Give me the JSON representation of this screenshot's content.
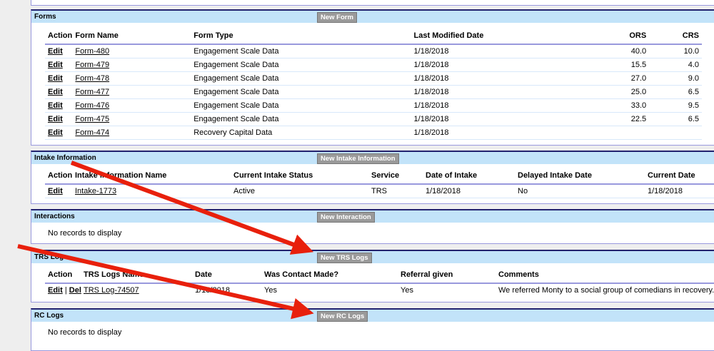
{
  "forms": {
    "title": "Forms",
    "new_button": "New Form",
    "headers": [
      "Action",
      "Form Name",
      "Form Type",
      "Last Modified Date",
      "ORS",
      "CRS"
    ],
    "rows": [
      {
        "action": "Edit",
        "name": "Form-480",
        "type": "Engagement Scale Data",
        "date": "1/18/2018",
        "ors": "40.0",
        "crs": "10.0"
      },
      {
        "action": "Edit",
        "name": "Form-479",
        "type": "Engagement Scale Data",
        "date": "1/18/2018",
        "ors": "15.5",
        "crs": "4.0"
      },
      {
        "action": "Edit",
        "name": "Form-478",
        "type": "Engagement Scale Data",
        "date": "1/18/2018",
        "ors": "27.0",
        "crs": "9.0"
      },
      {
        "action": "Edit",
        "name": "Form-477",
        "type": "Engagement Scale Data",
        "date": "1/18/2018",
        "ors": "25.0",
        "crs": "6.5"
      },
      {
        "action": "Edit",
        "name": "Form-476",
        "type": "Engagement Scale Data",
        "date": "1/18/2018",
        "ors": "33.0",
        "crs": "9.5"
      },
      {
        "action": "Edit",
        "name": "Form-475",
        "type": "Engagement Scale Data",
        "date": "1/18/2018",
        "ors": "22.5",
        "crs": "6.5"
      },
      {
        "action": "Edit",
        "name": "Form-474",
        "type": "Recovery Capital Data",
        "date": "1/18/2018",
        "ors": "",
        "crs": ""
      }
    ]
  },
  "intake": {
    "title": "Intake Information",
    "new_button": "New Intake Information",
    "headers": [
      "Action",
      "Intake Information Name",
      "Current Intake Status",
      "Service",
      "Date of Intake",
      "Delayed Intake Date",
      "Current Date"
    ],
    "rows": [
      {
        "action": "Edit",
        "name": "Intake-1773",
        "status": "Active",
        "service": "TRS",
        "date": "1/18/2018",
        "delayed": "No",
        "current": "1/18/2018"
      }
    ]
  },
  "interactions": {
    "title": "Interactions",
    "new_button": "New Interaction",
    "empty": "No records to display"
  },
  "trs": {
    "title": "TRS Logs",
    "new_button": "New TRS Logs",
    "headers": [
      "Action",
      "TRS Logs Name",
      "Date",
      "Was Contact Made?",
      "Referral given",
      "Comments"
    ],
    "rows": [
      {
        "edit": "Edit",
        "sep": "|",
        "del": "Del",
        "name": "TRS Log-74507",
        "date": "1/18/2018",
        "contact": "Yes",
        "referral": "Yes",
        "comments": "We referred Monty to a social group of comedians in recovery."
      }
    ]
  },
  "rc": {
    "title": "RC Logs",
    "new_button": "New RC Logs",
    "empty": "No records to display"
  },
  "colors": {
    "header_bg": "#c2e3f9",
    "arrow": "#e8200c"
  }
}
